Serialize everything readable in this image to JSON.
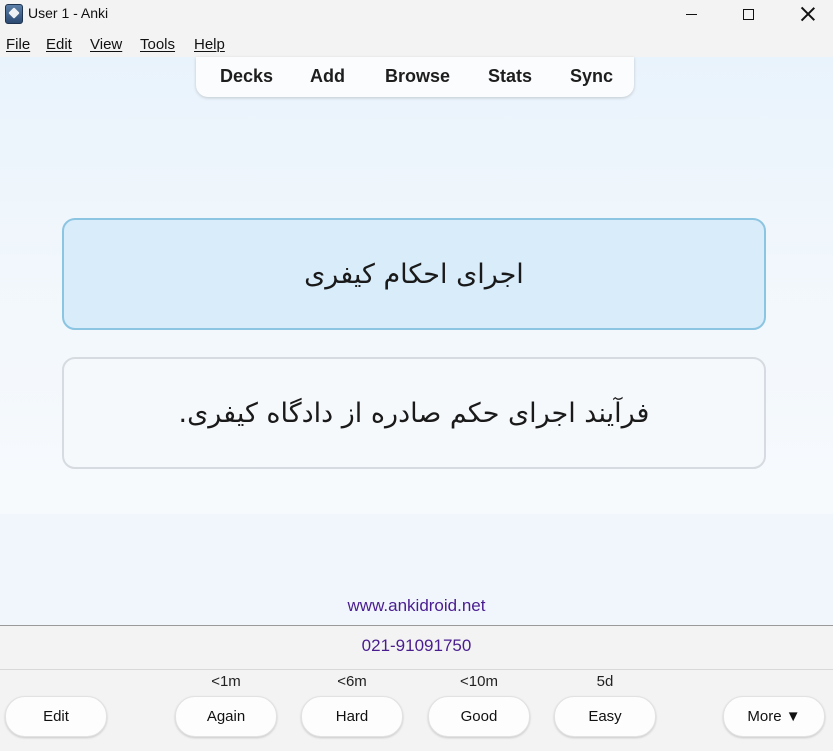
{
  "window": {
    "title": "User 1 - Anki"
  },
  "menu": [
    "File",
    "Edit",
    "View",
    "Tools",
    "Help"
  ],
  "toolbar": {
    "decks": "Decks",
    "add": "Add",
    "browse": "Browse",
    "stats": "Stats",
    "sync": "Sync"
  },
  "card": {
    "front": "اجرای احکام کیفری",
    "back": "فرآیند اجرای حکم صادره از دادگاه کیفری."
  },
  "footer": {
    "site": "www.ankidroid.net",
    "phone": "021-91091750",
    "link_color": "#4a1d8f"
  },
  "answer_bar": {
    "edit": "Edit",
    "more": "More ▼",
    "buttons": [
      {
        "label": "Again",
        "interval": "<1m"
      },
      {
        "label": "Hard",
        "interval": "<6m"
      },
      {
        "label": "Good",
        "interval": "<10m"
      },
      {
        "label": "Easy",
        "interval": "5d"
      }
    ]
  },
  "colors": {
    "front_bg": "#d8ecfa",
    "front_border": "#8cc5e2",
    "back_bg": "#f6f9fc"
  }
}
